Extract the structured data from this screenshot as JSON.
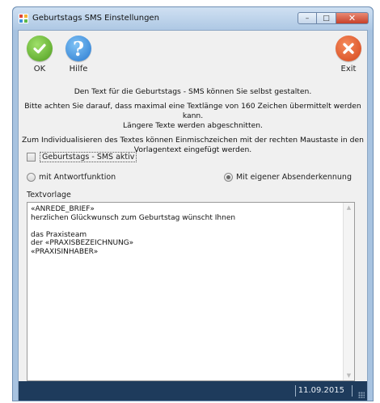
{
  "window": {
    "title": "Geburtstags SMS Einstellungen",
    "controls": {
      "minimize": "–",
      "maximize": "□",
      "close": "✕"
    }
  },
  "toolbar": {
    "ok_label": "OK",
    "help_label": "Hilfe",
    "help_glyph": "?",
    "exit_label": "Exit"
  },
  "info": {
    "line1": "Den Text für die Geburtstags - SMS können Sie selbst gestalten.",
    "line2": "Bitte achten Sie darauf, dass maximal eine Textlänge von 160 Zeichen übermittelt werden kann.",
    "line3": "Längere Texte werden abgeschnitten.",
    "line4": "Zum Individualisieren des Textes können Einmischzeichen mit der rechten Maustaste in den",
    "line5": "Vorlagentext eingefügt werden."
  },
  "options": {
    "sms_active_label": "Geburtstags - SMS aktiv",
    "sms_active_checked": false,
    "radio_reply_label": "mit Antwortfunktion",
    "radio_reply_selected": false,
    "radio_sender_label": "Mit eigener Absenderkennung",
    "radio_sender_selected": true
  },
  "template": {
    "label": "Textvorlage",
    "text": "«ANREDE_BRIEF»\nherzlichen Glückwunsch zum Geburtstag wünscht Ihnen\n\ndas Praxisteam\nder «PRAXISBEZEICHNUNG»\n«PRAXISINHABER»"
  },
  "status": {
    "date": "11.09.2015"
  },
  "colors": {
    "ok_green": "#5aa82a",
    "help_blue": "#2a7ad0",
    "exit_orange": "#d4461c",
    "status_bg": "#1e3b5c"
  },
  "icons": {
    "ok": "check-icon",
    "help": "question-icon",
    "exit": "close-x-icon"
  }
}
